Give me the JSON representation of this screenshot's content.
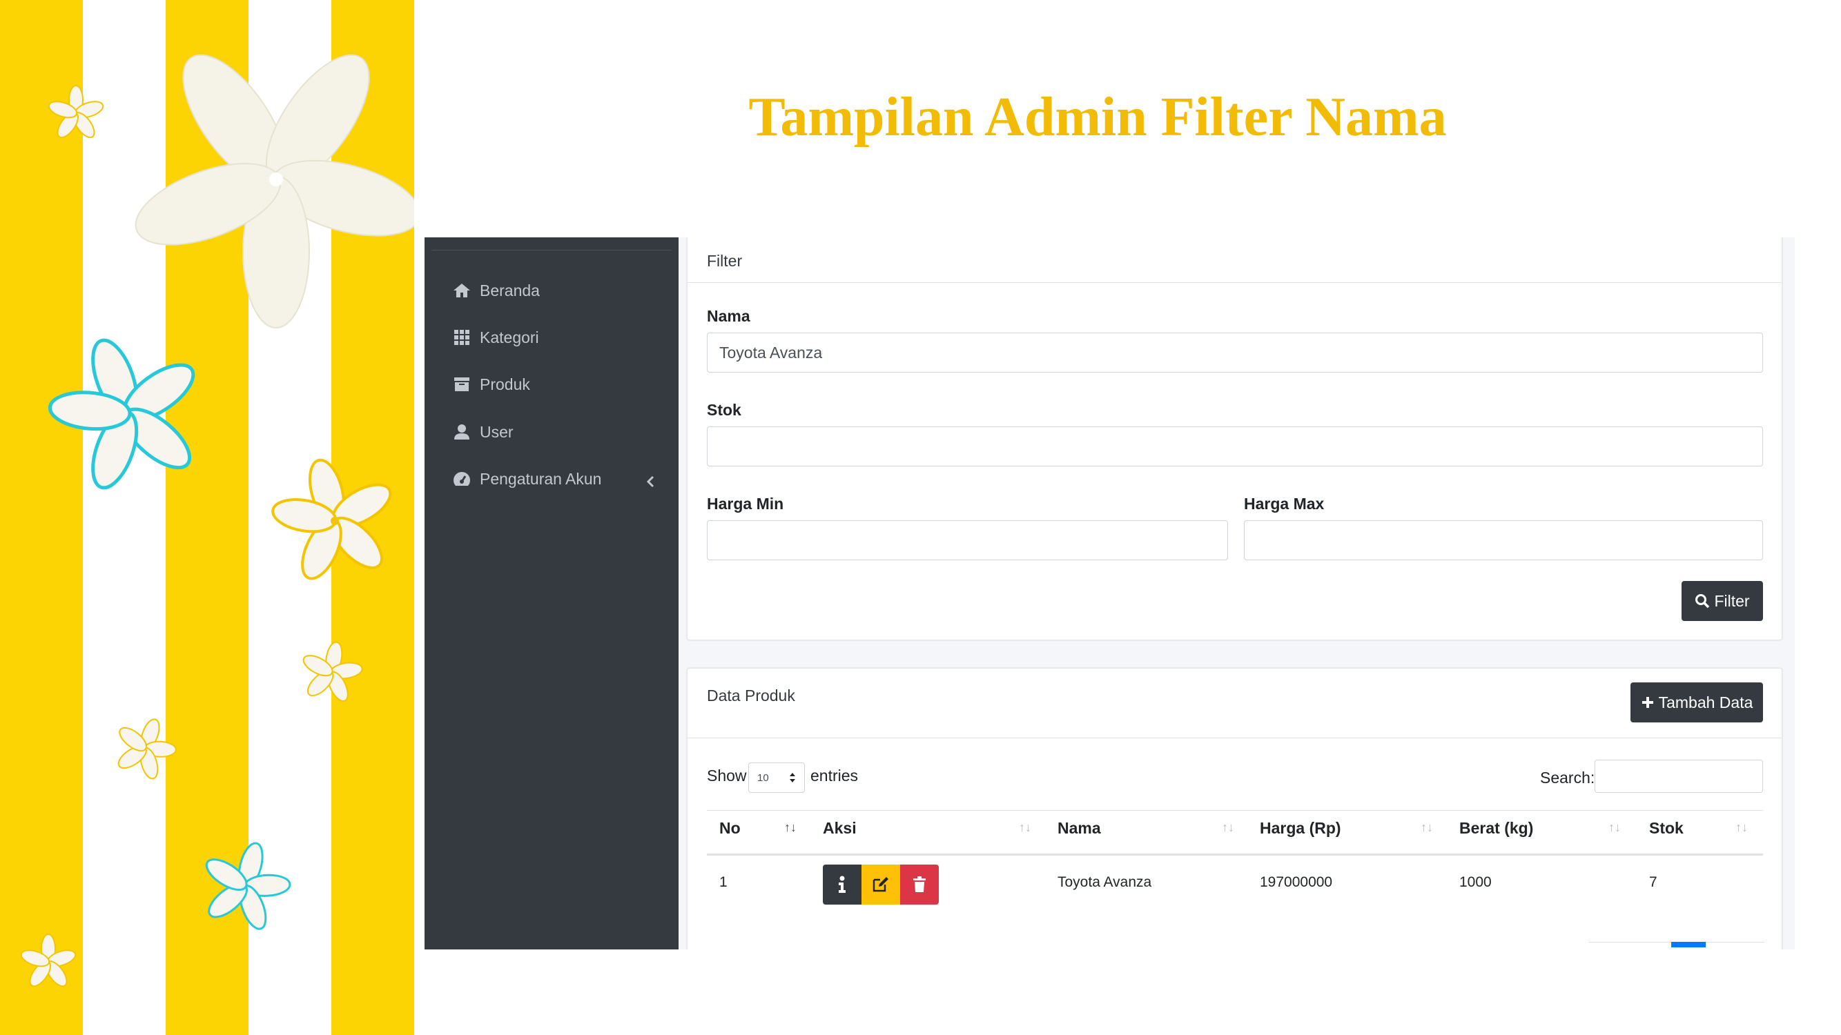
{
  "slide": {
    "title": "Tampilan Admin Filter Nama"
  },
  "sidebar": {
    "items": [
      {
        "label": "Beranda",
        "icon": "home-icon"
      },
      {
        "label": "Kategori",
        "icon": "grid-icon"
      },
      {
        "label": "Produk",
        "icon": "archive-icon"
      },
      {
        "label": "User",
        "icon": "user-icon"
      },
      {
        "label": "Pengaturan Akun",
        "icon": "dashboard-icon"
      }
    ]
  },
  "filter_card": {
    "title": "Filter",
    "nama_label": "Nama",
    "nama_value": "Toyota Avanza",
    "stok_label": "Stok",
    "stok_value": "",
    "harga_min_label": "Harga Min",
    "harga_min_value": "",
    "harga_max_label": "Harga Max",
    "harga_max_value": "",
    "filter_button": "Filter"
  },
  "data_card": {
    "title": "Data Produk",
    "add_button": "Tambah Data",
    "show_label": "Show",
    "entries_value": "10",
    "entries_label": "entries",
    "search_label": "Search:",
    "search_value": "",
    "columns": [
      "No",
      "Aksi",
      "Nama",
      "Harga (Rp)",
      "Berat (kg)",
      "Stok"
    ],
    "rows": [
      {
        "no": "1",
        "nama": "Toyota Avanza",
        "harga": "197000000",
        "berat": "1000",
        "stok": "7"
      }
    ]
  },
  "colors": {
    "stripe_yellow": "#fcd303",
    "title_gold": "#f2bb05",
    "sidebar_dark": "#343a40",
    "btn_warning": "#ffc107",
    "btn_danger": "#dc3545",
    "btn_primary": "#007bff"
  }
}
